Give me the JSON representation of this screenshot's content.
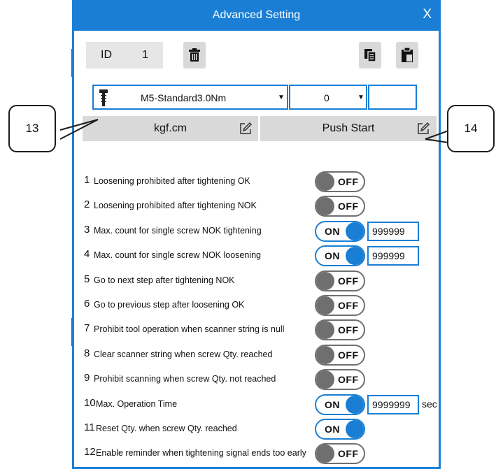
{
  "window": {
    "title": "Advanced Setting",
    "close_label": "X"
  },
  "header": {
    "id_label": "ID",
    "id_value": "1"
  },
  "selectors": {
    "screw_type": "M5-Standard3.0Nm",
    "step": "0",
    "extra": ""
  },
  "buttons": {
    "unit": "kgf.cm",
    "start_mode": "Push Start"
  },
  "callouts": {
    "left": "13",
    "right": "14"
  },
  "settings": [
    {
      "num": "1",
      "label": "Loosening prohibited after tightening OK",
      "state": "OFF"
    },
    {
      "num": "2",
      "label": "Loosening prohibited after tightening NOK",
      "state": "OFF"
    },
    {
      "num": "3",
      "label": "Max. count for single screw NOK tightening",
      "state": "ON",
      "value": "999999"
    },
    {
      "num": "4",
      "label": "Max. count for single screw NOK loosening",
      "state": "ON",
      "value": "999999"
    },
    {
      "num": "5",
      "label": "Go to next step after tightening NOK",
      "state": "OFF"
    },
    {
      "num": "6",
      "label": "Go to previous step after loosening OK",
      "state": "OFF"
    },
    {
      "num": "7",
      "label": "Prohibit tool operation when scanner string is null",
      "state": "OFF"
    },
    {
      "num": "8",
      "label": "Clear scanner string when screw Qty. reached",
      "state": "OFF"
    },
    {
      "num": "9",
      "label": "Prohibit scanning when screw Qty. not reached",
      "state": "OFF"
    },
    {
      "num": "10",
      "label": "Max. Operation Time",
      "state": "ON",
      "value": "9999999",
      "unit": "sec"
    },
    {
      "num": "11",
      "label": "Reset Qty. when screw Qty. reached",
      "state": "ON"
    },
    {
      "num": "12",
      "label": "Enable reminder when tightening signal ends too early",
      "state": "OFF"
    }
  ],
  "colors": {
    "accent": "#1a7fd4",
    "toggle_off": "#6f6f6f",
    "button_bg": "#d9d9d9"
  }
}
